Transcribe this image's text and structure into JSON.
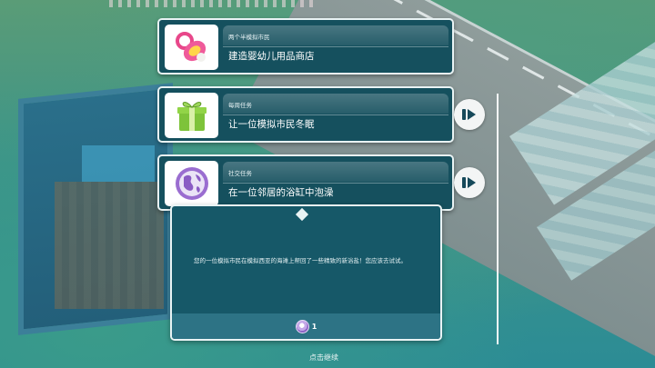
{
  "quests": [
    {
      "category": "两个半模拟市民",
      "title": "建造婴幼儿用品商店",
      "icon": "pacifier-icon",
      "skippable": false
    },
    {
      "category": "每周任务",
      "title": "让一位模拟市民冬眠",
      "icon": "gift-icon",
      "skippable": true
    },
    {
      "category": "社交任务",
      "title": "在一位邻居的浴缸中泡澡",
      "icon": "globe-icon",
      "skippable": true
    }
  ],
  "detail": {
    "description": "您的一位模拟市民在模拟西亚的海滩上帮回了一些精致的新浴盐！您应该去试试。",
    "reward_icon": "lifestyle-point-icon",
    "reward_count": "1"
  },
  "continue_hint": "点击继续",
  "colors": {
    "card_bg": "#15505e",
    "detail_bg": "#165868",
    "reward_bar": "#2d7385",
    "border": "#e9f3f4"
  }
}
